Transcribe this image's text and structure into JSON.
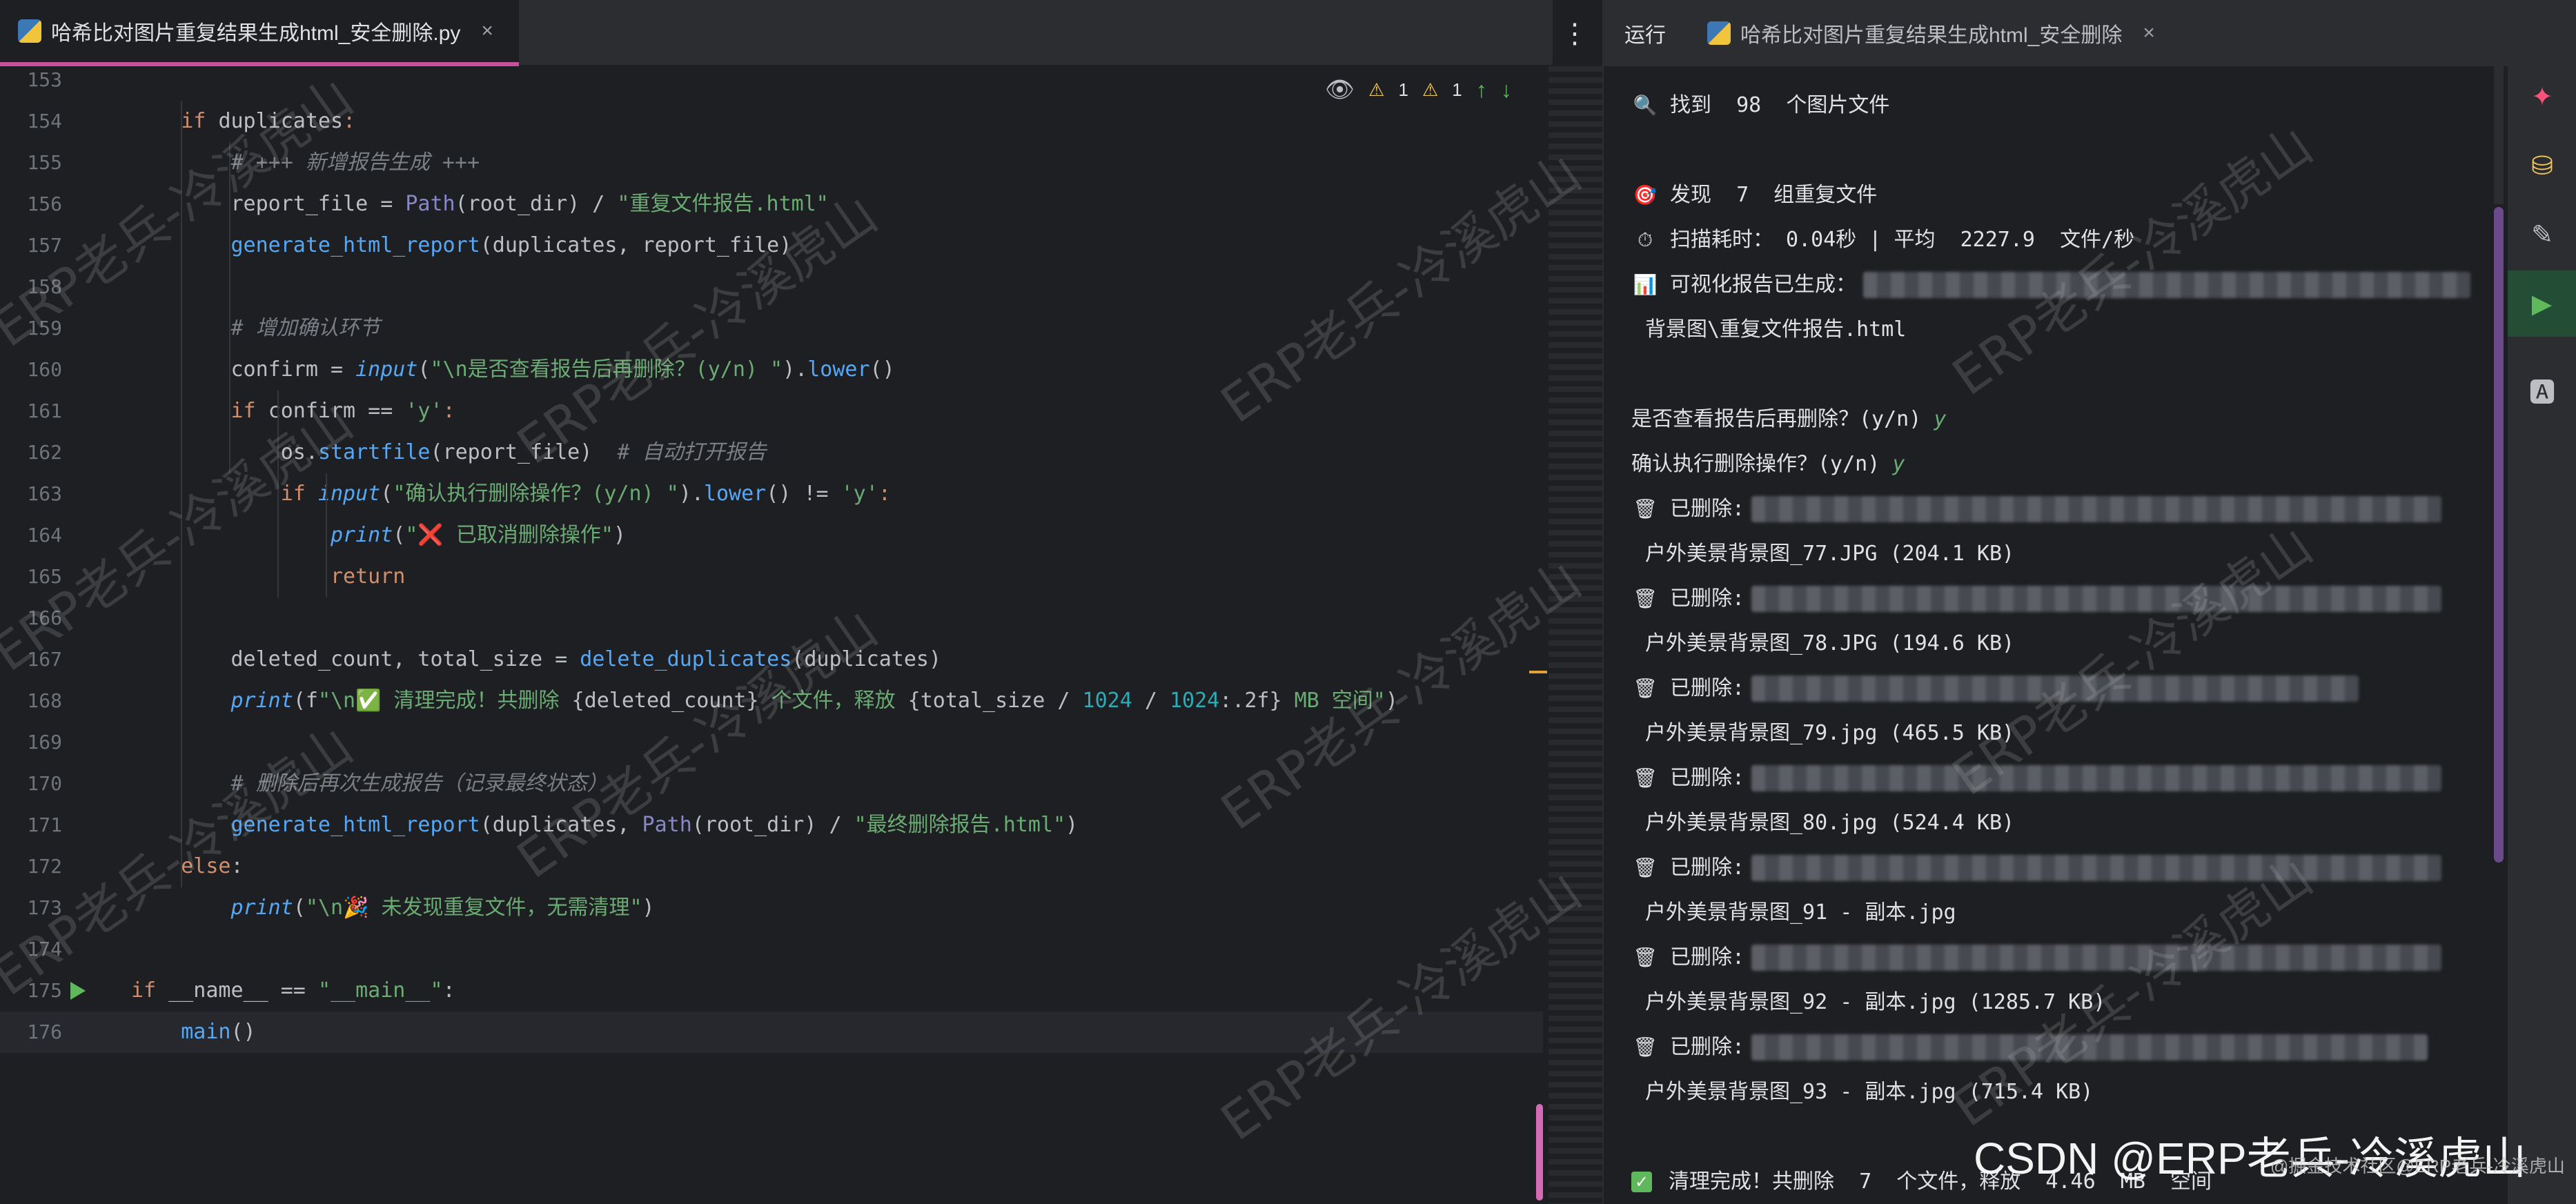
{
  "editor": {
    "tab": {
      "filename": "哈希比对图片重复结果生成html_安全删除.py",
      "close_glyph": "×"
    },
    "inline_status": {
      "warn1": "1",
      "warn2": "1"
    },
    "lines": [
      {
        "n": "153",
        "tokens": []
      },
      {
        "n": "154",
        "tokens": [
          [
            "k",
            "    if "
          ],
          [
            "p",
            "duplicates"
          ],
          [
            "k",
            ":"
          ]
        ]
      },
      {
        "n": "155",
        "tokens": [
          [
            "c",
            "        # +++ 新增报告生成 +++"
          ]
        ]
      },
      {
        "n": "156",
        "tokens": [
          [
            "p",
            "        report_file = "
          ],
          [
            "b",
            "Path"
          ],
          [
            "p",
            "(root_dir) / "
          ],
          [
            "s",
            "\"重复文件报告.html\""
          ]
        ]
      },
      {
        "n": "157",
        "tokens": [
          [
            "p",
            "        "
          ],
          [
            "f",
            "generate_html_report"
          ],
          [
            "p",
            "(duplicates, report_file)"
          ]
        ]
      },
      {
        "n": "158",
        "tokens": []
      },
      {
        "n": "159",
        "tokens": [
          [
            "c",
            "        # 增加确认环节"
          ]
        ]
      },
      {
        "n": "160",
        "tokens": [
          [
            "p",
            "        confirm = "
          ],
          [
            "fi",
            "input"
          ],
          [
            "p",
            "("
          ],
          [
            "s",
            "\"\\n是否查看报告后再删除？(y/n) \""
          ],
          [
            "p",
            ")."
          ],
          [
            "f",
            "lower"
          ],
          [
            "p",
            "()"
          ]
        ]
      },
      {
        "n": "161",
        "tokens": [
          [
            "k",
            "        if "
          ],
          [
            "p",
            "confirm == "
          ],
          [
            "s",
            "'y'"
          ],
          [
            "k",
            ":"
          ]
        ]
      },
      {
        "n": "162",
        "tokens": [
          [
            "p",
            "            os."
          ],
          [
            "f",
            "startfile"
          ],
          [
            "p",
            "(report_file)  "
          ],
          [
            "c",
            "# 自动打开报告"
          ]
        ]
      },
      {
        "n": "163",
        "tokens": [
          [
            "k",
            "            if "
          ],
          [
            "fi",
            "input"
          ],
          [
            "p",
            "("
          ],
          [
            "s",
            "\"确认执行删除操作？(y/n) \""
          ],
          [
            "p",
            ")."
          ],
          [
            "f",
            "lower"
          ],
          [
            "p",
            "() != "
          ],
          [
            "s",
            "'y'"
          ],
          [
            "k",
            ":"
          ]
        ]
      },
      {
        "n": "164",
        "tokens": [
          [
            "fi",
            "                print"
          ],
          [
            "p",
            "("
          ],
          [
            "s",
            "\"❌ 已取消删除操作\""
          ],
          [
            "p",
            ")"
          ]
        ]
      },
      {
        "n": "165",
        "tokens": [
          [
            "k",
            "                return"
          ]
        ]
      },
      {
        "n": "166",
        "tokens": []
      },
      {
        "n": "167",
        "tokens": [
          [
            "p",
            "        deleted_count, total_size = "
          ],
          [
            "f",
            "delete_duplicates"
          ],
          [
            "p",
            "(duplicates)"
          ]
        ]
      },
      {
        "n": "168",
        "tokens": [
          [
            "fi",
            "        print"
          ],
          [
            "p",
            "(f"
          ],
          [
            "s",
            "\"\\n✅ 清理完成！共删除 "
          ],
          [
            "p",
            "{deleted_count}"
          ],
          [
            "s",
            " 个文件，释放 "
          ],
          [
            "p",
            "{total_size / "
          ],
          [
            "n",
            "1024"
          ],
          [
            "p",
            " / "
          ],
          [
            "n",
            "1024"
          ],
          [
            "p",
            ":.2f}"
          ],
          [
            "s",
            " MB 空间\""
          ],
          [
            "p",
            ")"
          ]
        ]
      },
      {
        "n": "169",
        "tokens": []
      },
      {
        "n": "170",
        "tokens": [
          [
            "c",
            "        # 删除后再次生成报告（记录最终状态）"
          ]
        ]
      },
      {
        "n": "171",
        "tokens": [
          [
            "p",
            "        "
          ],
          [
            "f",
            "generate_html_report"
          ],
          [
            "p",
            "(duplicates, "
          ],
          [
            "b",
            "Path"
          ],
          [
            "p",
            "(root_dir) / "
          ],
          [
            "s",
            "\"最终删除报告.html\""
          ],
          [
            "p",
            ")"
          ]
        ]
      },
      {
        "n": "172",
        "tokens": [
          [
            "k",
            "    else"
          ],
          [
            "p",
            ":"
          ]
        ]
      },
      {
        "n": "173",
        "tokens": [
          [
            "fi",
            "        print"
          ],
          [
            "p",
            "("
          ],
          [
            "s",
            "\"\\n🎉 未发现重复文件，无需清理\""
          ],
          [
            "p",
            ")"
          ]
        ]
      },
      {
        "n": "174",
        "tokens": []
      },
      {
        "n": "175",
        "tokens": [
          [
            "k",
            "if "
          ],
          [
            "p",
            "__name__ == "
          ],
          [
            "s",
            "\"__main__\""
          ],
          [
            "p",
            ":"
          ]
        ]
      },
      {
        "n": "176",
        "tokens": [
          [
            "p",
            "    "
          ],
          [
            "f",
            "main"
          ],
          [
            "p",
            "()"
          ]
        ]
      }
    ]
  },
  "run_panel": {
    "label": "运行",
    "tab": "哈希比对图片重复结果生成html_安全删除",
    "close_glyph": "×",
    "console": {
      "found_images": "找到  98  个图片文件",
      "found_dups": "发现  7  组重复文件",
      "scan_time": "扫描耗时： 0.04秒 | 平均  2227.9  文件/秒",
      "report_generated": "可视化报告已生成：",
      "report_path_tail": "背景图\\重复文件报告.html",
      "ask_view": "是否查看报告后再删除？(y/n) ",
      "ask_confirm": "确认执行删除操作？(y/n) ",
      "answer": "y",
      "deleted_prefix": "已删除:",
      "deleted_files": [
        "户外美景背景图_77.JPG (204.1 KB)",
        "户外美景背景图_78.JPG (194.6 KB)",
        "户外美景背景图_79.jpg (465.5 KB)",
        "户外美景背景图_80.jpg (524.4 KB)",
        "户外美景背景图_91 - 副本.jpg",
        "户外美景背景图_92 - 副本.jpg (1285.7 KB)",
        "户外美景背景图_93 - 副本.jpg (715.4 KB)"
      ],
      "done": "清理完成！共删除  7  个文件，释放  4.46  MB  空间"
    }
  },
  "watermark": {
    "text": "ERP老兵-冷溪虎山",
    "csdn": "CSDN @ERP老兵-冷溪虎山",
    "csdn_small": "@掘金技术社区@ERP老兵-冷溪虎山"
  },
  "colors": {
    "accent_tab": "#c94f9c",
    "run_green": "#5fb85c"
  }
}
